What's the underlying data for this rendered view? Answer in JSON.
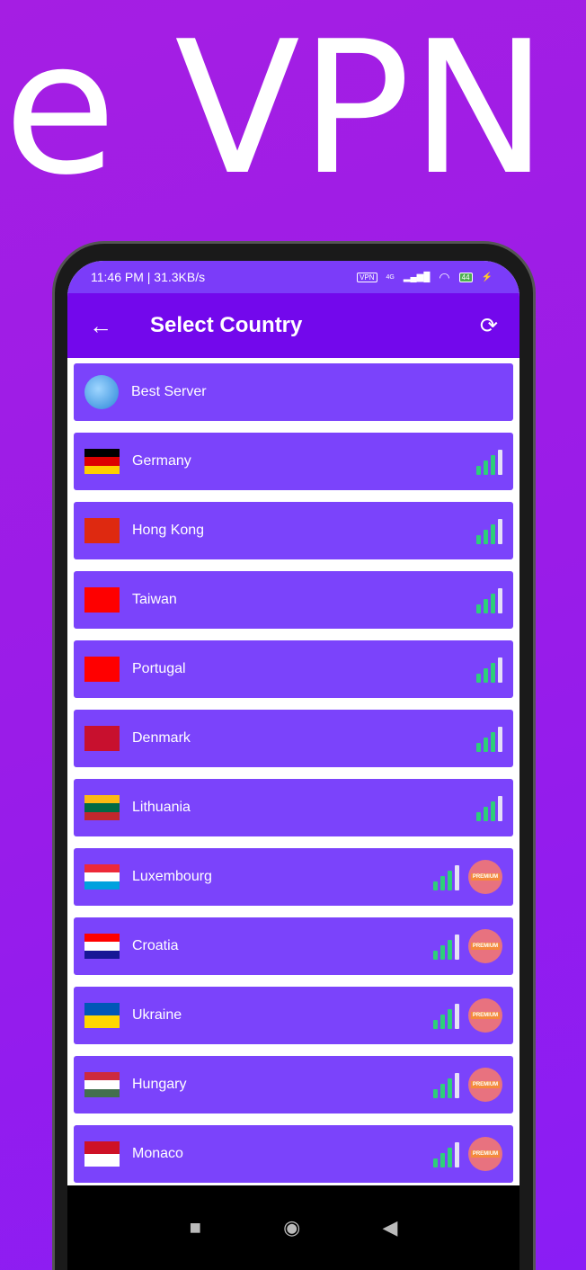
{
  "hero_text": "e VPN",
  "status": {
    "time": "11:46 PM | 31.3KB/s",
    "vpn": "VPN",
    "network": "4G",
    "battery": "44"
  },
  "appbar": {
    "title": "Select Country"
  },
  "countries": [
    {
      "name": "Best Server",
      "icon": "globe",
      "premium": false,
      "signal": false
    },
    {
      "name": "Germany",
      "flag": [
        "#000000",
        "#dd0000",
        "#ffce00"
      ],
      "premium": false,
      "signal": true
    },
    {
      "name": "Hong Kong",
      "flag": [
        "#de2910"
      ],
      "premium": false,
      "signal": true
    },
    {
      "name": "Taiwan",
      "flag": [
        "#fe0000"
      ],
      "premium": false,
      "signal": true
    },
    {
      "name": "Portugal",
      "flag": [
        "#ff0000"
      ],
      "premium": false,
      "signal": true
    },
    {
      "name": "Denmark",
      "flag": [
        "#c8102e"
      ],
      "premium": false,
      "signal": true
    },
    {
      "name": "Lithuania",
      "flag": [
        "#fdb913",
        "#006a44",
        "#c1272d"
      ],
      "premium": false,
      "signal": true
    },
    {
      "name": "Luxembourg",
      "flag": [
        "#ed2939",
        "#ffffff",
        "#00a1de"
      ],
      "premium": true,
      "signal": true
    },
    {
      "name": "Croatia",
      "flag": [
        "#ff0000",
        "#ffffff",
        "#171796"
      ],
      "premium": true,
      "signal": true
    },
    {
      "name": "Ukraine",
      "flag": [
        "#0057b7",
        "#ffd700"
      ],
      "premium": true,
      "signal": true
    },
    {
      "name": "Hungary",
      "flag": [
        "#cd2a3e",
        "#ffffff",
        "#436f4d"
      ],
      "premium": true,
      "signal": true
    },
    {
      "name": "Monaco",
      "flag": [
        "#ce1126",
        "#ffffff"
      ],
      "premium": true,
      "signal": true
    }
  ],
  "premium_label": "PREMIUM"
}
